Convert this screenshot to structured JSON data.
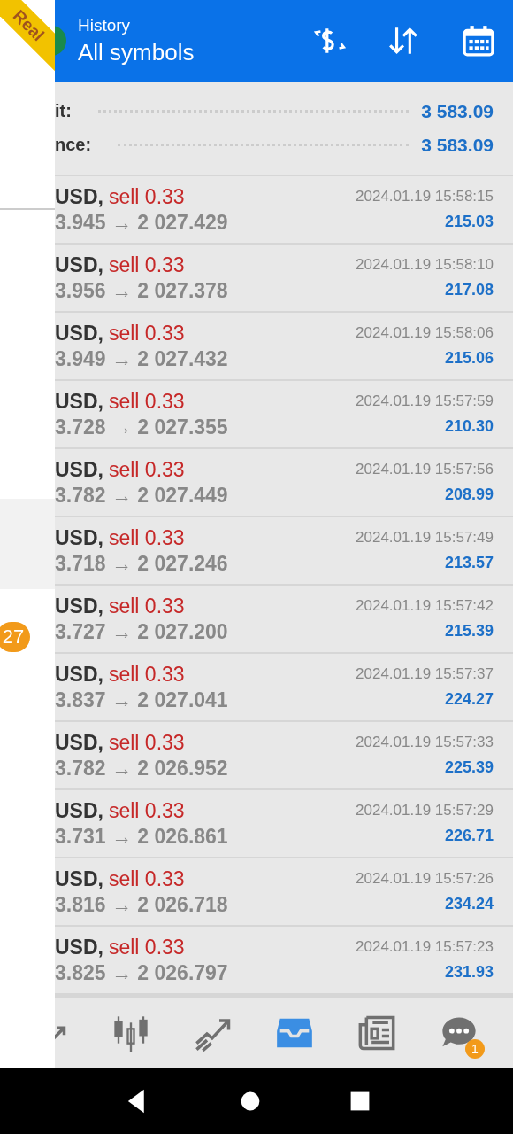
{
  "drawer": {
    "ribbon": "Real",
    "counter_badge": "27"
  },
  "header": {
    "subtitle": "History",
    "title": "All symbols",
    "actions": [
      {
        "kind": "currency"
      },
      {
        "kind": "sort"
      },
      {
        "kind": "calendar"
      }
    ]
  },
  "summary": [
    {
      "label": "it:",
      "value": "3 583.09"
    },
    {
      "label": "nce:",
      "value": "3 583.09"
    }
  ],
  "deals": [
    {
      "symbol": "USD,",
      "side": "sell 0.33",
      "prices": "3.945 → 2 027.429",
      "time": "2024.01.19 15:58:15",
      "profit": "215.03"
    },
    {
      "symbol": "USD,",
      "side": "sell 0.33",
      "prices": "3.956 → 2 027.378",
      "time": "2024.01.19 15:58:10",
      "profit": "217.08"
    },
    {
      "symbol": "USD,",
      "side": "sell 0.33",
      "prices": "3.949 → 2 027.432",
      "time": "2024.01.19 15:58:06",
      "profit": "215.06"
    },
    {
      "symbol": "USD,",
      "side": "sell 0.33",
      "prices": "3.728 → 2 027.355",
      "time": "2024.01.19 15:57:59",
      "profit": "210.30"
    },
    {
      "symbol": "USD,",
      "side": "sell 0.33",
      "prices": "3.782 → 2 027.449",
      "time": "2024.01.19 15:57:56",
      "profit": "208.99"
    },
    {
      "symbol": "USD,",
      "side": "sell 0.33",
      "prices": "3.718 → 2 027.246",
      "time": "2024.01.19 15:57:49",
      "profit": "213.57"
    },
    {
      "symbol": "USD,",
      "side": "sell 0.33",
      "prices": "3.727 → 2 027.200",
      "time": "2024.01.19 15:57:42",
      "profit": "215.39"
    },
    {
      "symbol": "USD,",
      "side": "sell 0.33",
      "prices": "3.837 → 2 027.041",
      "time": "2024.01.19 15:57:37",
      "profit": "224.27"
    },
    {
      "symbol": "USD,",
      "side": "sell 0.33",
      "prices": "3.782 → 2 026.952",
      "time": "2024.01.19 15:57:33",
      "profit": "225.39"
    },
    {
      "symbol": "USD,",
      "side": "sell 0.33",
      "prices": "3.731 → 2 026.861",
      "time": "2024.01.19 15:57:29",
      "profit": "226.71"
    },
    {
      "symbol": "USD,",
      "side": "sell 0.33",
      "prices": "3.816 → 2 026.718",
      "time": "2024.01.19 15:57:26",
      "profit": "234.24"
    },
    {
      "symbol": "USD,",
      "side": "sell 0.33",
      "prices": "3.825 → 2 026.797",
      "time": "2024.01.19 15:57:23",
      "profit": "231.93"
    }
  ],
  "nav": [
    {
      "kind": "quotes",
      "selected": false
    },
    {
      "kind": "chart",
      "selected": false
    },
    {
      "kind": "trade",
      "selected": false
    },
    {
      "kind": "history",
      "selected": true
    },
    {
      "kind": "news",
      "selected": false
    },
    {
      "kind": "chat",
      "selected": false,
      "badge": "1"
    }
  ],
  "system_nav": [
    {
      "kind": "back"
    },
    {
      "kind": "home"
    },
    {
      "kind": "recents"
    }
  ]
}
